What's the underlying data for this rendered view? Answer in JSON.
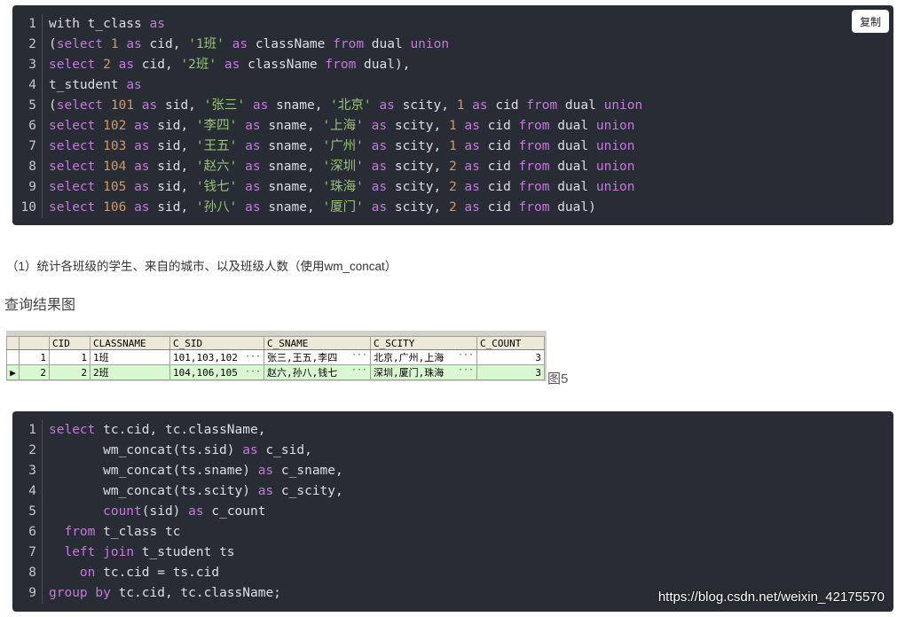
{
  "copy_button_label": "复制",
  "code_block_1": [
    {
      "n": "1",
      "tokens": [
        [
          "t",
          "with t_class "
        ],
        [
          "kw",
          "as"
        ]
      ]
    },
    {
      "n": "2",
      "tokens": [
        [
          "t",
          "("
        ],
        [
          "kw",
          "select"
        ],
        [
          "t",
          " "
        ],
        [
          "num",
          "1"
        ],
        [
          "t",
          " "
        ],
        [
          "kw",
          "as"
        ],
        [
          "t",
          " cid, "
        ],
        [
          "str",
          "'1班'"
        ],
        [
          "t",
          " "
        ],
        [
          "kw",
          "as"
        ],
        [
          "t",
          " className "
        ],
        [
          "kw",
          "from"
        ],
        [
          "t",
          " dual "
        ],
        [
          "kw",
          "union"
        ]
      ]
    },
    {
      "n": "3",
      "tokens": [
        [
          "kw",
          "select"
        ],
        [
          "t",
          " "
        ],
        [
          "num",
          "2"
        ],
        [
          "t",
          " "
        ],
        [
          "kw",
          "as"
        ],
        [
          "t",
          " cid, "
        ],
        [
          "str",
          "'2班'"
        ],
        [
          "t",
          " "
        ],
        [
          "kw",
          "as"
        ],
        [
          "t",
          " className "
        ],
        [
          "kw",
          "from"
        ],
        [
          "t",
          " dual),"
        ]
      ]
    },
    {
      "n": "4",
      "tokens": [
        [
          "t",
          "t_student "
        ],
        [
          "kw",
          "as"
        ]
      ]
    },
    {
      "n": "5",
      "tokens": [
        [
          "t",
          "("
        ],
        [
          "kw",
          "select"
        ],
        [
          "t",
          " "
        ],
        [
          "num",
          "101"
        ],
        [
          "t",
          " "
        ],
        [
          "kw",
          "as"
        ],
        [
          "t",
          " sid, "
        ],
        [
          "str",
          "'张三'"
        ],
        [
          "t",
          " "
        ],
        [
          "kw",
          "as"
        ],
        [
          "t",
          " sname, "
        ],
        [
          "str",
          "'北京'"
        ],
        [
          "t",
          " "
        ],
        [
          "kw",
          "as"
        ],
        [
          "t",
          " scity, "
        ],
        [
          "num",
          "1"
        ],
        [
          "t",
          " "
        ],
        [
          "kw",
          "as"
        ],
        [
          "t",
          " cid "
        ],
        [
          "kw",
          "from"
        ],
        [
          "t",
          " dual "
        ],
        [
          "kw",
          "union"
        ]
      ]
    },
    {
      "n": "6",
      "tokens": [
        [
          "kw",
          "select"
        ],
        [
          "t",
          " "
        ],
        [
          "num",
          "102"
        ],
        [
          "t",
          " "
        ],
        [
          "kw",
          "as"
        ],
        [
          "t",
          " sid, "
        ],
        [
          "str",
          "'李四'"
        ],
        [
          "t",
          " "
        ],
        [
          "kw",
          "as"
        ],
        [
          "t",
          " sname, "
        ],
        [
          "str",
          "'上海'"
        ],
        [
          "t",
          " "
        ],
        [
          "kw",
          "as"
        ],
        [
          "t",
          " scity, "
        ],
        [
          "num",
          "1"
        ],
        [
          "t",
          " "
        ],
        [
          "kw",
          "as"
        ],
        [
          "t",
          " cid "
        ],
        [
          "kw",
          "from"
        ],
        [
          "t",
          " dual "
        ],
        [
          "kw",
          "union"
        ]
      ]
    },
    {
      "n": "7",
      "tokens": [
        [
          "kw",
          "select"
        ],
        [
          "t",
          " "
        ],
        [
          "num",
          "103"
        ],
        [
          "t",
          " "
        ],
        [
          "kw",
          "as"
        ],
        [
          "t",
          " sid, "
        ],
        [
          "str",
          "'王五'"
        ],
        [
          "t",
          " "
        ],
        [
          "kw",
          "as"
        ],
        [
          "t",
          " sname, "
        ],
        [
          "str",
          "'广州'"
        ],
        [
          "t",
          " "
        ],
        [
          "kw",
          "as"
        ],
        [
          "t",
          " scity, "
        ],
        [
          "num",
          "1"
        ],
        [
          "t",
          " "
        ],
        [
          "kw",
          "as"
        ],
        [
          "t",
          " cid "
        ],
        [
          "kw",
          "from"
        ],
        [
          "t",
          " dual "
        ],
        [
          "kw",
          "union"
        ]
      ]
    },
    {
      "n": "8",
      "tokens": [
        [
          "kw",
          "select"
        ],
        [
          "t",
          " "
        ],
        [
          "num",
          "104"
        ],
        [
          "t",
          " "
        ],
        [
          "kw",
          "as"
        ],
        [
          "t",
          " sid, "
        ],
        [
          "str",
          "'赵六'"
        ],
        [
          "t",
          " "
        ],
        [
          "kw",
          "as"
        ],
        [
          "t",
          " sname, "
        ],
        [
          "str",
          "'深圳'"
        ],
        [
          "t",
          " "
        ],
        [
          "kw",
          "as"
        ],
        [
          "t",
          " scity, "
        ],
        [
          "num",
          "2"
        ],
        [
          "t",
          " "
        ],
        [
          "kw",
          "as"
        ],
        [
          "t",
          " cid "
        ],
        [
          "kw",
          "from"
        ],
        [
          "t",
          " dual "
        ],
        [
          "kw",
          "union"
        ]
      ]
    },
    {
      "n": "9",
      "tokens": [
        [
          "kw",
          "select"
        ],
        [
          "t",
          " "
        ],
        [
          "num",
          "105"
        ],
        [
          "t",
          " "
        ],
        [
          "kw",
          "as"
        ],
        [
          "t",
          " sid, "
        ],
        [
          "str",
          "'钱七'"
        ],
        [
          "t",
          " "
        ],
        [
          "kw",
          "as"
        ],
        [
          "t",
          " sname, "
        ],
        [
          "str",
          "'珠海'"
        ],
        [
          "t",
          " "
        ],
        [
          "kw",
          "as"
        ],
        [
          "t",
          " scity, "
        ],
        [
          "num",
          "2"
        ],
        [
          "t",
          " "
        ],
        [
          "kw",
          "as"
        ],
        [
          "t",
          " cid "
        ],
        [
          "kw",
          "from"
        ],
        [
          "t",
          " dual "
        ],
        [
          "kw",
          "union"
        ]
      ]
    },
    {
      "n": "10",
      "tokens": [
        [
          "kw",
          "select"
        ],
        [
          "t",
          " "
        ],
        [
          "num",
          "106"
        ],
        [
          "t",
          " "
        ],
        [
          "kw",
          "as"
        ],
        [
          "t",
          " sid, "
        ],
        [
          "str",
          "'孙八'"
        ],
        [
          "t",
          " "
        ],
        [
          "kw",
          "as"
        ],
        [
          "t",
          " sname, "
        ],
        [
          "str",
          "'厦门'"
        ],
        [
          "t",
          " "
        ],
        [
          "kw",
          "as"
        ],
        [
          "t",
          " scity, "
        ],
        [
          "num",
          "2"
        ],
        [
          "t",
          " "
        ],
        [
          "kw",
          "as"
        ],
        [
          "t",
          " cid "
        ],
        [
          "kw",
          "from"
        ],
        [
          "t",
          " dual)"
        ]
      ]
    }
  ],
  "paragraph": "（1）统计各班级的学生、来自的城市、以及班级人数（使用wm_concat）",
  "heading": "查询结果图",
  "result_grid": {
    "columns": [
      "CID",
      "CLASSNAME",
      "C_SID",
      "C_SNAME",
      "C_SCITY",
      "C_COUNT"
    ],
    "rows": [
      {
        "rownum": "1",
        "indicator": "",
        "cid": "1",
        "classname": "1班",
        "c_sid": "101,103,102",
        "c_sname": "张三,王五,李四",
        "c_scity": "北京,广州,上海",
        "c_count": "3"
      },
      {
        "rownum": "2",
        "indicator": "▶",
        "cid": "2",
        "classname": "2班",
        "c_sid": "104,106,105",
        "c_sname": "赵六,孙八,钱七",
        "c_scity": "深圳,厦门,珠海",
        "c_count": "3"
      }
    ],
    "ellipsis": "···"
  },
  "figure_label": "图5",
  "code_block_2": [
    {
      "n": "1",
      "tokens": [
        [
          "kw",
          "select"
        ],
        [
          "t",
          " tc.cid, tc.className,"
        ]
      ]
    },
    {
      "n": "2",
      "tokens": [
        [
          "t",
          "       wm_concat(ts.sid) "
        ],
        [
          "kw",
          "as"
        ],
        [
          "t",
          " c_sid,"
        ]
      ]
    },
    {
      "n": "3",
      "tokens": [
        [
          "t",
          "       wm_concat(ts.sname) "
        ],
        [
          "kw",
          "as"
        ],
        [
          "t",
          " c_sname,"
        ]
      ]
    },
    {
      "n": "4",
      "tokens": [
        [
          "t",
          "       wm_concat(ts.scity) "
        ],
        [
          "kw",
          "as"
        ],
        [
          "t",
          " c_scity,"
        ]
      ]
    },
    {
      "n": "5",
      "tokens": [
        [
          "t",
          "       "
        ],
        [
          "kw",
          "count"
        ],
        [
          "t",
          "(sid) "
        ],
        [
          "kw",
          "as"
        ],
        [
          "t",
          " c_count"
        ]
      ]
    },
    {
      "n": "6",
      "tokens": [
        [
          "t",
          "  "
        ],
        [
          "kw",
          "from"
        ],
        [
          "t",
          " t_class tc"
        ]
      ]
    },
    {
      "n": "7",
      "tokens": [
        [
          "t",
          "  "
        ],
        [
          "kw",
          "left"
        ],
        [
          "t",
          " "
        ],
        [
          "kw",
          "join"
        ],
        [
          "t",
          " t_student ts"
        ]
      ]
    },
    {
      "n": "8",
      "tokens": [
        [
          "t",
          "    "
        ],
        [
          "kw",
          "on"
        ],
        [
          "t",
          " tc.cid = ts.cid"
        ]
      ]
    },
    {
      "n": "9",
      "tokens": [
        [
          "kw",
          "group"
        ],
        [
          "t",
          " "
        ],
        [
          "kw",
          "by"
        ],
        [
          "t",
          " tc.cid, tc.className;"
        ]
      ]
    }
  ],
  "watermark": "https://blog.csdn.net/weixin_42175570"
}
